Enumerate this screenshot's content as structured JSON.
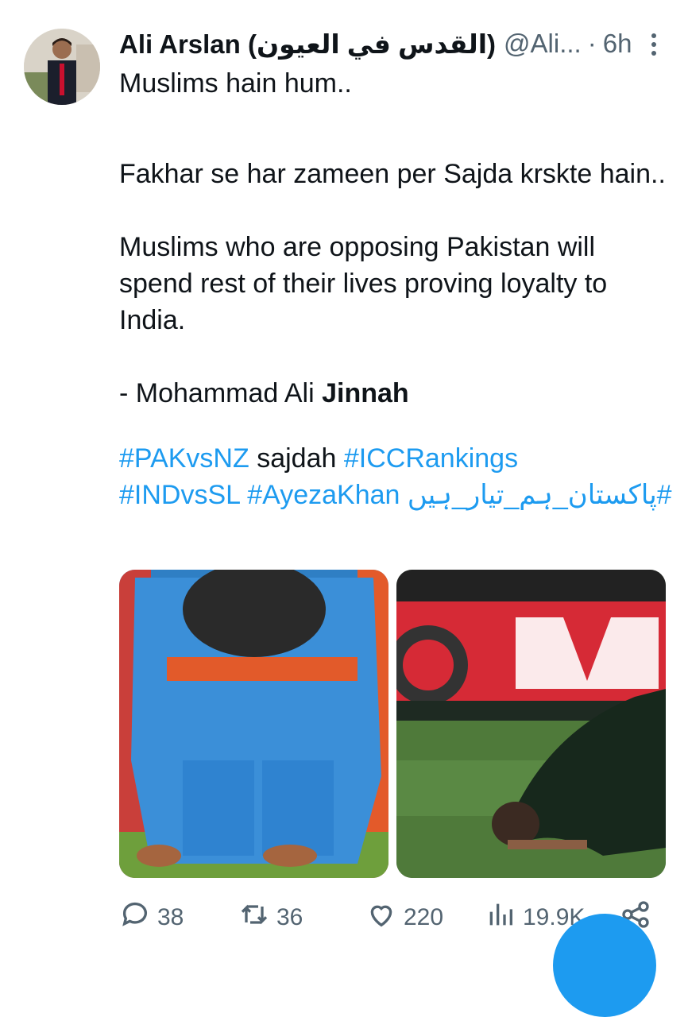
{
  "author": {
    "name": "Ali Arslan (القدس في العيون)",
    "handle": "@Ali...",
    "separator": "·",
    "time": "6h"
  },
  "tweet": {
    "line1": "Muslims hain hum..",
    "line2": "Fakhar se har zameen per Sajda krskte hain..",
    "line3": "Muslims who are opposing Pakistan will spend rest of their lives proving loyalty to India.",
    "quote_prefix": "- Mohammad Ali ",
    "quote_bold": "Jinnah",
    "tags": {
      "t1": "#PAKvsNZ",
      "word": "sajdah",
      "t2": "#ICCRankings",
      "t3": "#INDvsSL",
      "t4": "#AyezaKhan",
      "t5": "#پاکستان_ہم_تیار_ہیں"
    }
  },
  "stats": {
    "replies": "38",
    "retweets": "36",
    "likes": "220",
    "views": "19.9K"
  },
  "colors": {
    "accent": "#1d9bf0",
    "muted": "#536471"
  },
  "icons": [
    "more-icon",
    "reply-icon",
    "retweet-icon",
    "like-icon",
    "views-icon",
    "share-icon"
  ]
}
